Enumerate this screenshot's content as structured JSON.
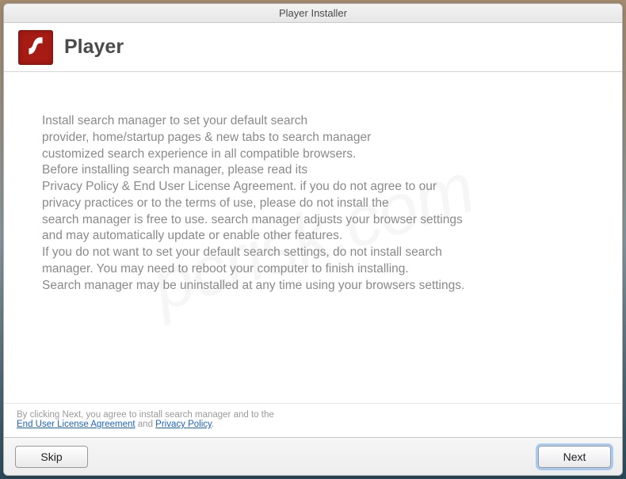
{
  "titlebar": {
    "title": "Player Installer"
  },
  "header": {
    "title": "Player",
    "icon_name": "flash-icon"
  },
  "body": {
    "text": "Install search manager to set your default search\nprovider, home/startup pages & new tabs to search manager\ncustomized search experience in all compatible browsers.\nBefore installing search manager, please read its\nPrivacy Policy & End User License Agreement. if you do not agree to our\nprivacy practices or to the terms of use, please do not install the\nsearch manager is free to use. search manager adjusts your browser settings\nand may automatically update or enable other features.\nIf you do not want to set your default search settings, do not install search\nmanager. You may need to reboot your computer to finish installing.\nSearch manager may be uninstalled at any time using your browsers settings."
  },
  "agreement": {
    "line1": "By clicking Next, you agree to install search manager and to the",
    "eula_label": "End User License Agreement",
    "and_text": " and ",
    "privacy_label": "Privacy Policy",
    "period": "."
  },
  "footer": {
    "skip_label": "Skip",
    "next_label": "Next"
  },
  "watermark": {
    "text": "pcrisk.com"
  }
}
